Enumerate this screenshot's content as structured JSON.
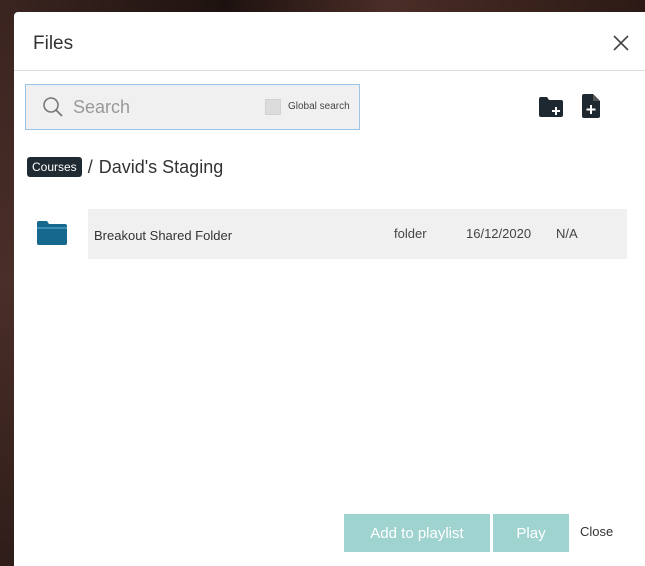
{
  "modal": {
    "title": "Files"
  },
  "search": {
    "placeholder": "Search",
    "value": "",
    "global_search_label": "Global search",
    "global_search_checked": false
  },
  "toolbar": {
    "new_folder_icon": "folder-plus-icon",
    "new_file_icon": "file-plus-icon"
  },
  "breadcrumb": {
    "root_label": "Courses",
    "separator": "/",
    "current_label": "David's Staging"
  },
  "files": [
    {
      "icon": "folder-icon",
      "name": "Breakout Shared Folder",
      "type": "folder",
      "date": "16/12/2020",
      "size": "N/A"
    }
  ],
  "footer": {
    "add_to_playlist_label": "Add to playlist",
    "play_label": "Play",
    "close_label": "Close"
  },
  "colors": {
    "accent_button": "#9fd3cf",
    "breadcrumb_chip": "#1f2a33",
    "folder_icon": "#1a6a8f",
    "search_border": "#9cc4e8"
  }
}
